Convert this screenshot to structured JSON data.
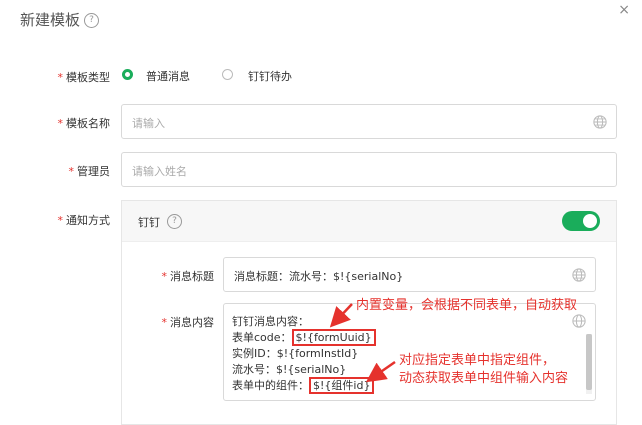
{
  "dialog": {
    "title": "新建模板",
    "close_symbol": "×"
  },
  "form": {
    "template_type": {
      "label": "模板类型",
      "options": [
        {
          "label": "普通消息",
          "selected": true
        },
        {
          "label": "钉钉待办",
          "selected": false
        }
      ]
    },
    "template_name": {
      "label": "模板名称",
      "placeholder": "请输入",
      "value": ""
    },
    "admin": {
      "label": "管理员",
      "placeholder": "请输入姓名",
      "value": ""
    },
    "notify_method": {
      "label": "通知方式",
      "channel": "钉钉",
      "enabled": true,
      "message_title": {
        "label": "消息标题",
        "value": "消息标题：流水号：$!{serialNo}"
      },
      "message_content": {
        "label": "消息内容",
        "lines": [
          {
            "text": "钉钉消息内容：",
            "var": ""
          },
          {
            "text": "表单code：",
            "var": "$!{formUuid}"
          },
          {
            "text": "实例ID：$!{formInstId}",
            "var": ""
          },
          {
            "text": "流水号：$!{serialNo}",
            "var": ""
          },
          {
            "text": "表单中的组件：",
            "var": "$!{组件id}"
          }
        ]
      }
    }
  },
  "annotations": {
    "note1": "内置变量，会根据不同表单，自动获取",
    "note2_line1": "对应指定表单中指定组件，",
    "note2_line2": "动态获取表单中组件输入内容"
  },
  "colors": {
    "accent": "#1aad5b",
    "required": "#e5322d",
    "annotation": "#e5322d"
  },
  "icons": [
    "help-circle-icon",
    "close-icon",
    "globe-icon"
  ]
}
